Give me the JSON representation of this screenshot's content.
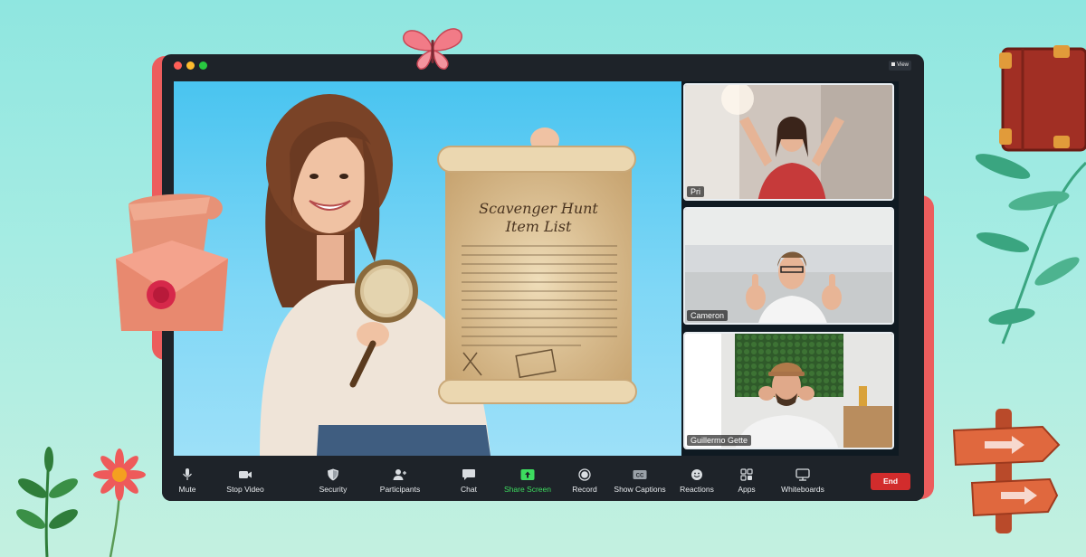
{
  "window": {
    "view_label": "View"
  },
  "stage": {
    "scroll_title_line1": "Scavenger Hunt",
    "scroll_title_line2": "Item List"
  },
  "participants": [
    {
      "name": "Pri"
    },
    {
      "name": "Cameron"
    },
    {
      "name": "Guillermo Gette"
    }
  ],
  "toolbar": {
    "items": [
      {
        "label": "Mute",
        "icon": "microphone-icon"
      },
      {
        "label": "Stop Video",
        "icon": "video-camera-icon"
      },
      {
        "label": "Security",
        "icon": "shield-icon"
      },
      {
        "label": "Participants",
        "icon": "participants-icon"
      },
      {
        "label": "Chat",
        "icon": "chat-bubble-icon"
      },
      {
        "label": "Share Screen",
        "icon": "share-screen-icon"
      },
      {
        "label": "Record",
        "icon": "record-icon"
      },
      {
        "label": "Show Captions",
        "icon": "captions-icon"
      },
      {
        "label": "Reactions",
        "icon": "smiley-icon"
      },
      {
        "label": "Apps",
        "icon": "apps-icon"
      },
      {
        "label": "Whiteboards",
        "icon": "whiteboard-icon"
      }
    ],
    "end_label": "End"
  },
  "colors": {
    "background": "#9ee9e2",
    "frame_red": "#ec5d5d",
    "toolbar": "#1e2329",
    "share_green": "#3ddc5f",
    "end_red": "#d22c2c",
    "stage_blue": "#5cc9f2"
  }
}
